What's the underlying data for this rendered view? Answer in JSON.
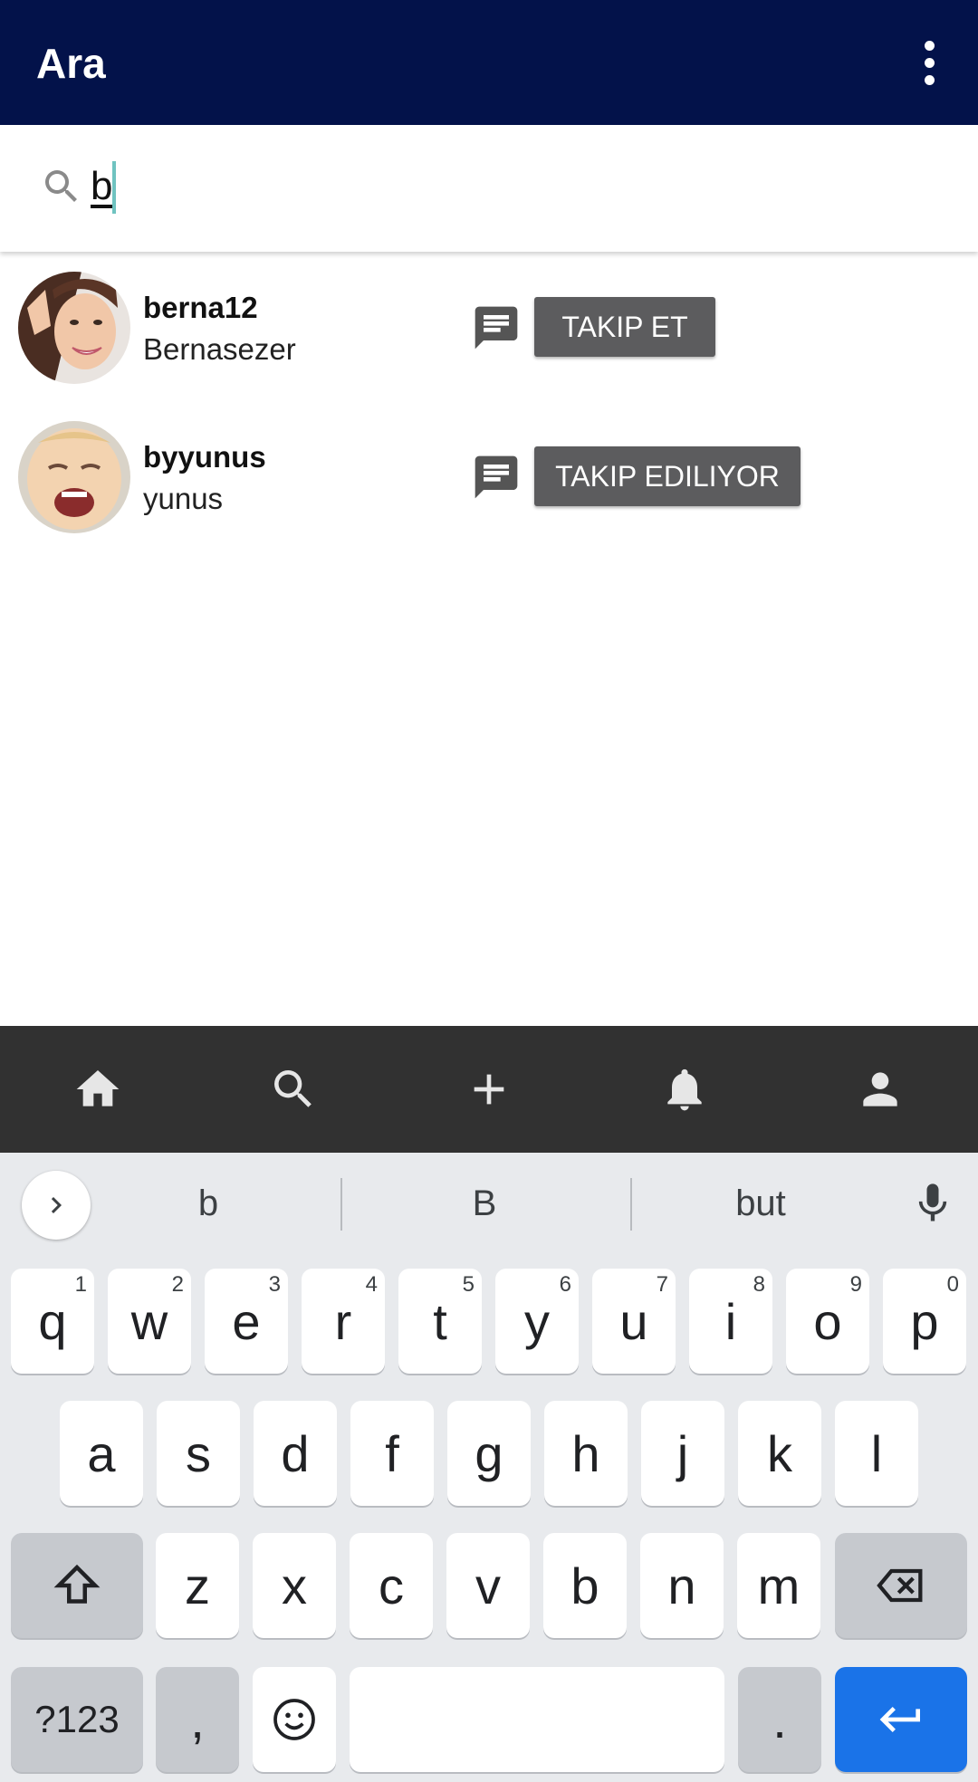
{
  "app_bar": {
    "title": "Ara",
    "more_icon": "more-vert-icon"
  },
  "search": {
    "value": "b",
    "icon": "search-icon"
  },
  "results": [
    {
      "username": "berna12",
      "full_name": "Bernasezer",
      "follow_label": "TAKIP ET",
      "avatar": "avatar-woman"
    },
    {
      "username": "byyunus",
      "full_name": "yunus",
      "follow_label": "TAKIP EDILIYOR",
      "avatar": "avatar-baby"
    }
  ],
  "bottom_nav": [
    "home-icon",
    "search-icon",
    "add-icon",
    "notifications-icon",
    "profile-icon"
  ],
  "keyboard": {
    "suggestions": [
      "b",
      "B",
      "but"
    ],
    "row1": [
      {
        "k": "q",
        "h": "1"
      },
      {
        "k": "w",
        "h": "2"
      },
      {
        "k": "e",
        "h": "3"
      },
      {
        "k": "r",
        "h": "4"
      },
      {
        "k": "t",
        "h": "5"
      },
      {
        "k": "y",
        "h": "6"
      },
      {
        "k": "u",
        "h": "7"
      },
      {
        "k": "i",
        "h": "8"
      },
      {
        "k": "o",
        "h": "9"
      },
      {
        "k": "p",
        "h": "0"
      }
    ],
    "row2": [
      "a",
      "s",
      "d",
      "f",
      "g",
      "h",
      "j",
      "k",
      "l"
    ],
    "row3": [
      "z",
      "x",
      "c",
      "v",
      "b",
      "n",
      "m"
    ],
    "symbols_label": "?123",
    "comma": ",",
    "period": "."
  }
}
